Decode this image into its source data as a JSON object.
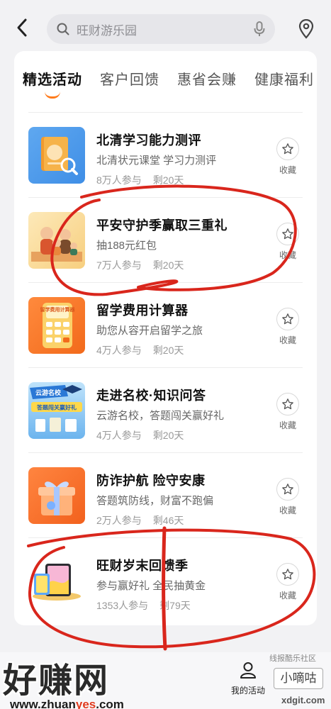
{
  "search": {
    "placeholder": "旺财游乐园"
  },
  "tabs": [
    {
      "label": "精选活动",
      "active": true
    },
    {
      "label": "客户回馈",
      "active": false
    },
    {
      "label": "惠省会赚",
      "active": false
    },
    {
      "label": "健康福利",
      "active": false
    }
  ],
  "activities": [
    {
      "title": "北清学习能力测评",
      "subtitle": "北清状元课堂 学习力测评",
      "participants": "8万人参与",
      "remaining": "剩20天",
      "fav_label": "收藏",
      "thumb_icon": "book-icon"
    },
    {
      "title": "平安守护季赢取三重礼",
      "subtitle": "抽188元红包",
      "participants": "7万人参与",
      "remaining": "剩20天",
      "fav_label": "收藏",
      "thumb_icon": "family-icon"
    },
    {
      "title": "留学费用计算器",
      "subtitle": "助您从容开启留学之旅",
      "participants": "4万人参与",
      "remaining": "剩20天",
      "fav_label": "收藏",
      "thumb_icon": "calculator-icon",
      "thumb_text": "留学费用计算器"
    },
    {
      "title": "走进名校·知识问答",
      "subtitle": "云游名校，答题闯关赢好礼",
      "participants": "4万人参与",
      "remaining": "剩20天",
      "fav_label": "收藏",
      "thumb_icon": "school-quiz-icon",
      "thumb_text_1": "云游名校",
      "thumb_text_2": "答题闯关赢好礼"
    },
    {
      "title": "防诈护航 险守安康",
      "subtitle": "答题筑防线，财富不跑偏",
      "participants": "2万人参与",
      "remaining": "剩46天",
      "fav_label": "收藏",
      "thumb_icon": "gift-box-icon"
    },
    {
      "title": "旺财岁末回馈季",
      "subtitle": "参与赢好礼 全民抽黄金",
      "participants": "1353人参与",
      "remaining": "剩79天",
      "fav_label": "收藏",
      "thumb_icon": "tablet-icon"
    }
  ],
  "bottom": {
    "my_activities_label": "我的活动"
  },
  "watermark": {
    "logo": "好赚网",
    "url_prefix": "www.zhuan",
    "url_highlight": "yes",
    "url_suffix": ".com",
    "right_top": "线报酷乐社区",
    "right_box": "小嘀咕",
    "right_bottom": "xdgit.com"
  },
  "colors": {
    "accent": "#ff7a1a",
    "annotation_red": "#d9261c"
  }
}
